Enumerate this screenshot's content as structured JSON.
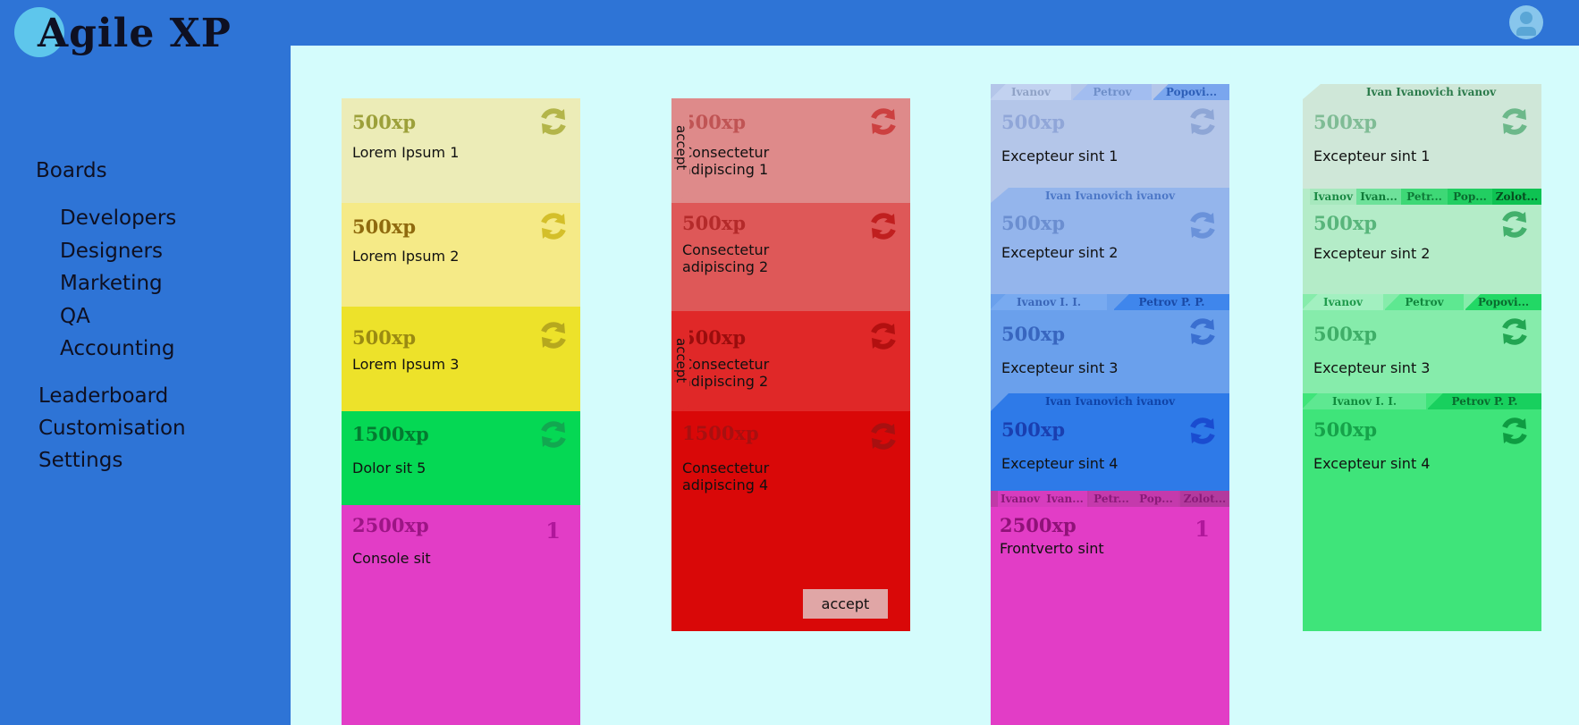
{
  "app": {
    "logo": "Agile XP"
  },
  "nav": {
    "boards": "Boards",
    "sub": [
      "Developers",
      "Designers",
      "Marketing",
      "QA",
      "Accounting"
    ],
    "leaderboard": "Leaderboard",
    "customisation": "Customisation",
    "settings": "Settings"
  },
  "columns": [
    {
      "cards": [
        {
          "xp": "500xp",
          "title": "Lorem Ipsum 1"
        },
        {
          "xp": "500xp",
          "title": "Lorem Ipsum 2"
        },
        {
          "xp": "500xp",
          "title": "Lorem Ipsum 3"
        },
        {
          "xp": "1500xp",
          "title": "Dolor sit 5"
        },
        {
          "xp": "2500xp",
          "title": "Console sit",
          "badge": "1"
        }
      ]
    },
    {
      "cards": [
        {
          "xp": "500xp",
          "title": "Consectetur adipiscing 1",
          "side": "accept"
        },
        {
          "xp": "500xp",
          "title": "Consectetur adipiscing 2"
        },
        {
          "xp": "500xp",
          "title": "Consectetur adipiscing 2",
          "side": "accept"
        },
        {
          "xp": "1500xp",
          "title": "Consectetur adipiscing 4",
          "button": "accept"
        }
      ]
    },
    {
      "cards": [
        {
          "xp": "500xp",
          "title": "Excepteur sint 1",
          "tabs": [
            "Ivanov",
            "Petrov",
            "Popovi..."
          ]
        },
        {
          "xp": "500xp",
          "title": "Excepteur sint 2",
          "tabs": [
            "Ivan Ivanovich ivanov"
          ]
        },
        {
          "xp": "500xp",
          "title": "Excepteur sint 3",
          "tabs": [
            "Ivanov I. I.",
            "Petrov P. P."
          ]
        },
        {
          "xp": "500xp",
          "title": "Excepteur sint 4",
          "tabs": [
            "Ivan Ivanovich ivanov"
          ]
        },
        {
          "xp": "2500xp",
          "title": "Frontverto sint",
          "badge": "1",
          "tabs": [
            "Ivanov",
            "Ivan...",
            "Petr...",
            "Pop...",
            "Zolot..."
          ]
        }
      ]
    },
    {
      "cards": [
        {
          "xp": "500xp",
          "title": "Excepteur sint 1",
          "tabs": [
            "Ivan Ivanovich ivanov"
          ]
        },
        {
          "xp": "500xp",
          "title": "Excepteur sint 2",
          "tabs": [
            "Ivanov",
            "Ivan...",
            "Petr...",
            "Pop...",
            "Zolot..."
          ]
        },
        {
          "xp": "500xp",
          "title": "Excepteur sint 3",
          "tabs": [
            "Ivanov",
            "Petrov",
            "Popovi..."
          ]
        },
        {
          "xp": "500xp",
          "title": "Excepteur sint 4",
          "tabs": [
            "Ivanov I. I.",
            "Petrov P. P."
          ]
        }
      ]
    }
  ],
  "colors": {
    "sidebar": "#2e74d6",
    "board": "#d4fcfc",
    "col1": [
      "#ececb7",
      "#f5ea87",
      "#ede22a",
      "#05d854",
      "#e23dc6"
    ],
    "col2": [
      "#de8a8a",
      "#de5858",
      "#e02828",
      "#d90808"
    ],
    "col3": [
      "#b4c6e9",
      "#94b5ec",
      "#6aa0ec",
      "#2e7ae8",
      "#e23dc6"
    ],
    "col4": [
      "#cfe7d8",
      "#b4ecc8",
      "#86ecab",
      "#3fe47a"
    ]
  }
}
